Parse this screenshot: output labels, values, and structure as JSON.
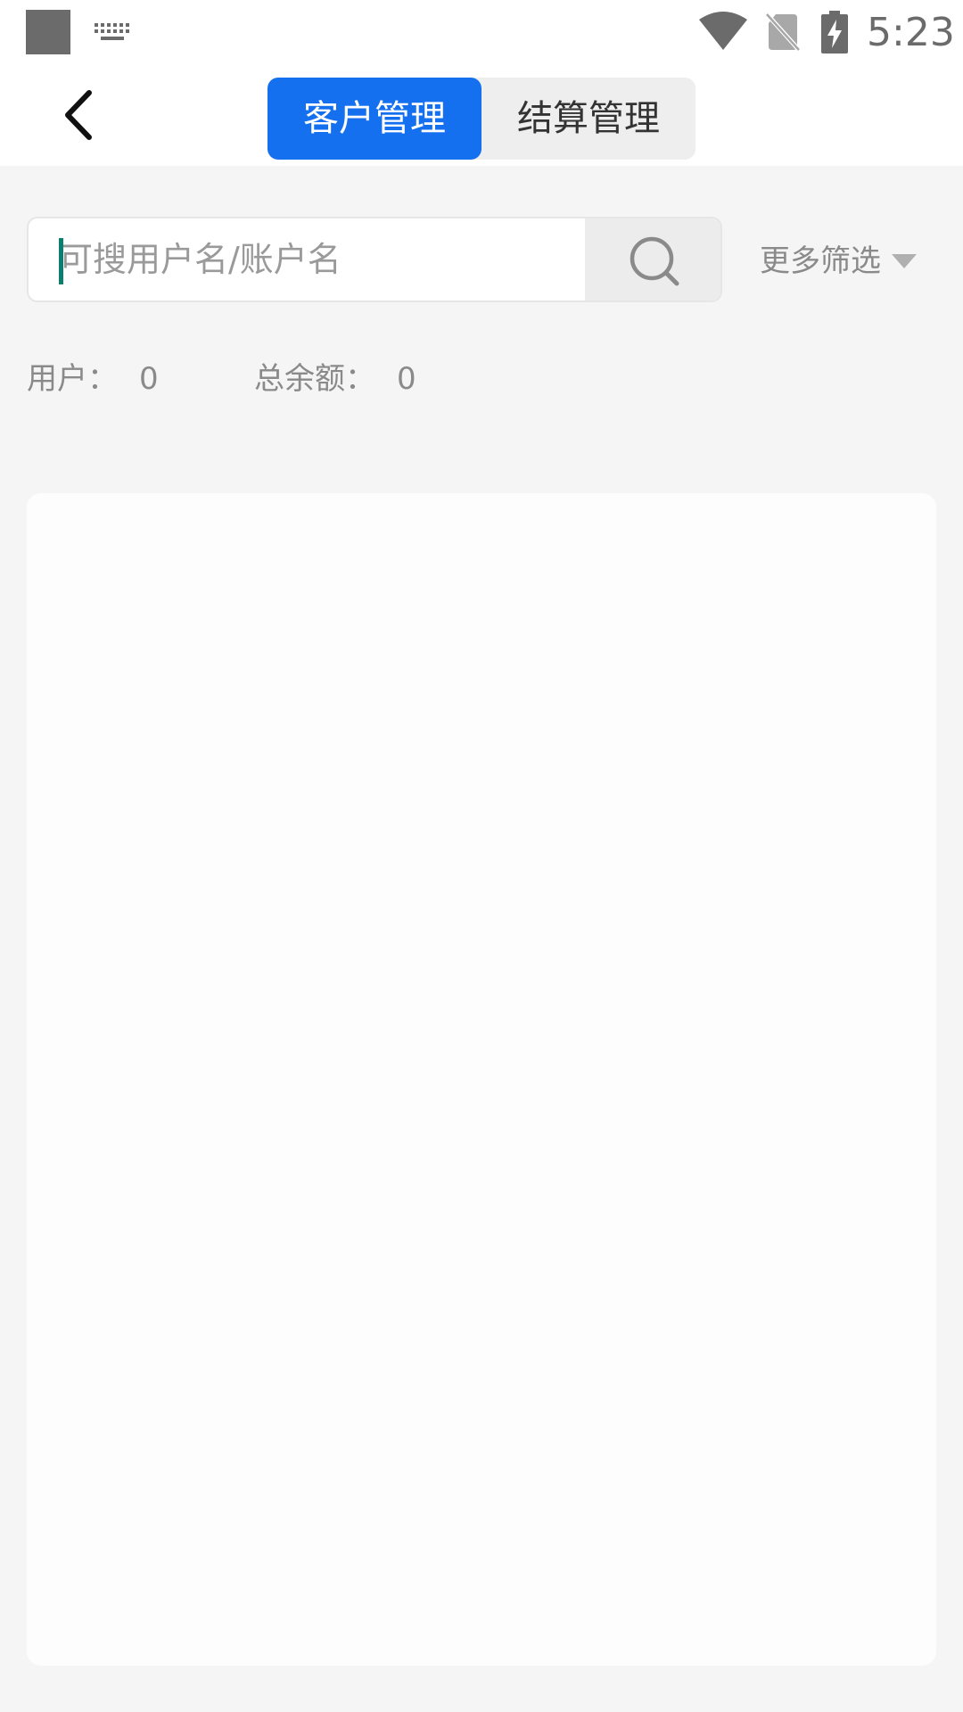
{
  "status_bar": {
    "time": "5:23",
    "icons": [
      "app-icon",
      "keyboard-icon",
      "wifi-icon",
      "no-sim-icon",
      "battery-charging-icon"
    ]
  },
  "header": {
    "back_icon": "chevron-left-icon",
    "tabs": [
      {
        "label": "客户管理",
        "active": true
      },
      {
        "label": "结算管理",
        "active": false
      }
    ]
  },
  "search": {
    "placeholder": "可搜用户名/账户名",
    "value": "",
    "button_icon": "search-icon"
  },
  "filter": {
    "label": "更多筛选",
    "icon": "caret-down-icon"
  },
  "stats": {
    "users_label": "用户：",
    "users_value": "0",
    "balance_label": "总余额：",
    "balance_value": "0"
  },
  "list": {
    "items": []
  },
  "colors": {
    "accent": "#1570ef",
    "background": "#f5f5f5",
    "muted_text": "#8a8a8a",
    "cursor": "#0b7f6d"
  }
}
